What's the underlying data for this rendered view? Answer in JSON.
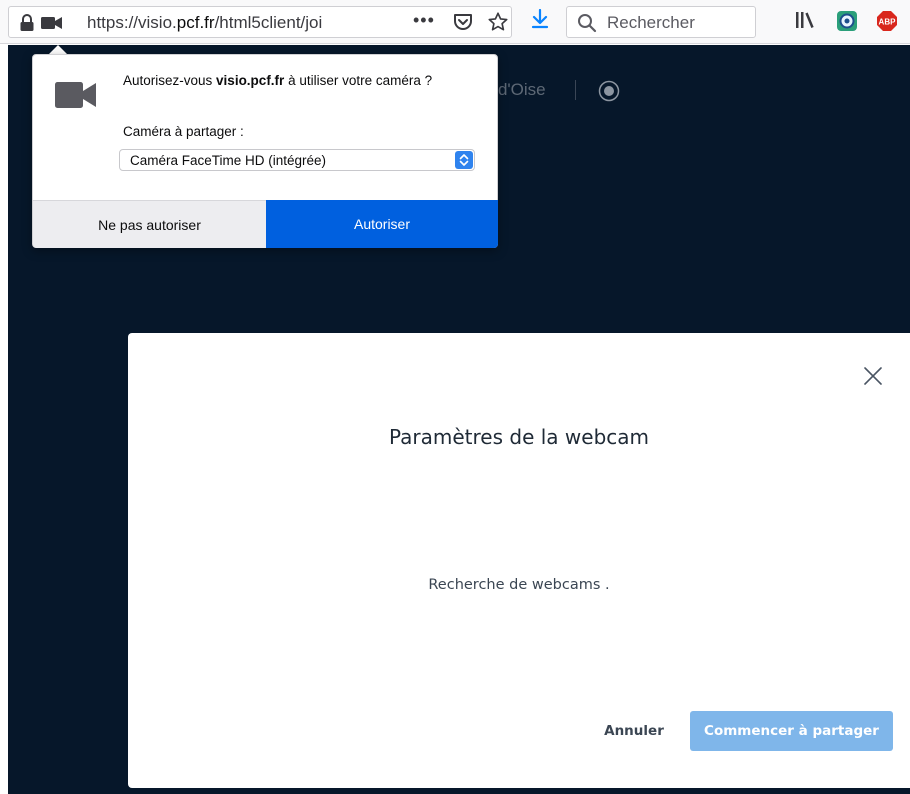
{
  "browser": {
    "url_prefix": "https://visio.",
    "url_domain": "pcf.fr",
    "url_suffix": "/html5client/joi",
    "overflow_menu": "•••",
    "search_placeholder": "Rechercher",
    "abp_label": "ABP"
  },
  "page": {
    "header_fragment": "al d'Oise"
  },
  "permission_popup": {
    "question_prefix": "Autorisez-vous ",
    "question_domain": "visio.pcf.fr",
    "question_suffix": " à utiliser votre caméra ?",
    "camera_label": "Caméra à partager :",
    "selected_camera": "Caméra FaceTime HD (intégrée)",
    "deny_label": "Ne pas autoriser",
    "allow_label": "Autoriser"
  },
  "webcam_modal": {
    "title": "Paramètres de la webcam",
    "status": "Recherche de webcams .",
    "cancel_label": "Annuler",
    "start_label": "Commencer à partager"
  },
  "colors": {
    "page_background": "#06172a",
    "allow_button": "#0060df",
    "start_button": "#7fb6ea",
    "download_arrow": "#0a84ff"
  }
}
